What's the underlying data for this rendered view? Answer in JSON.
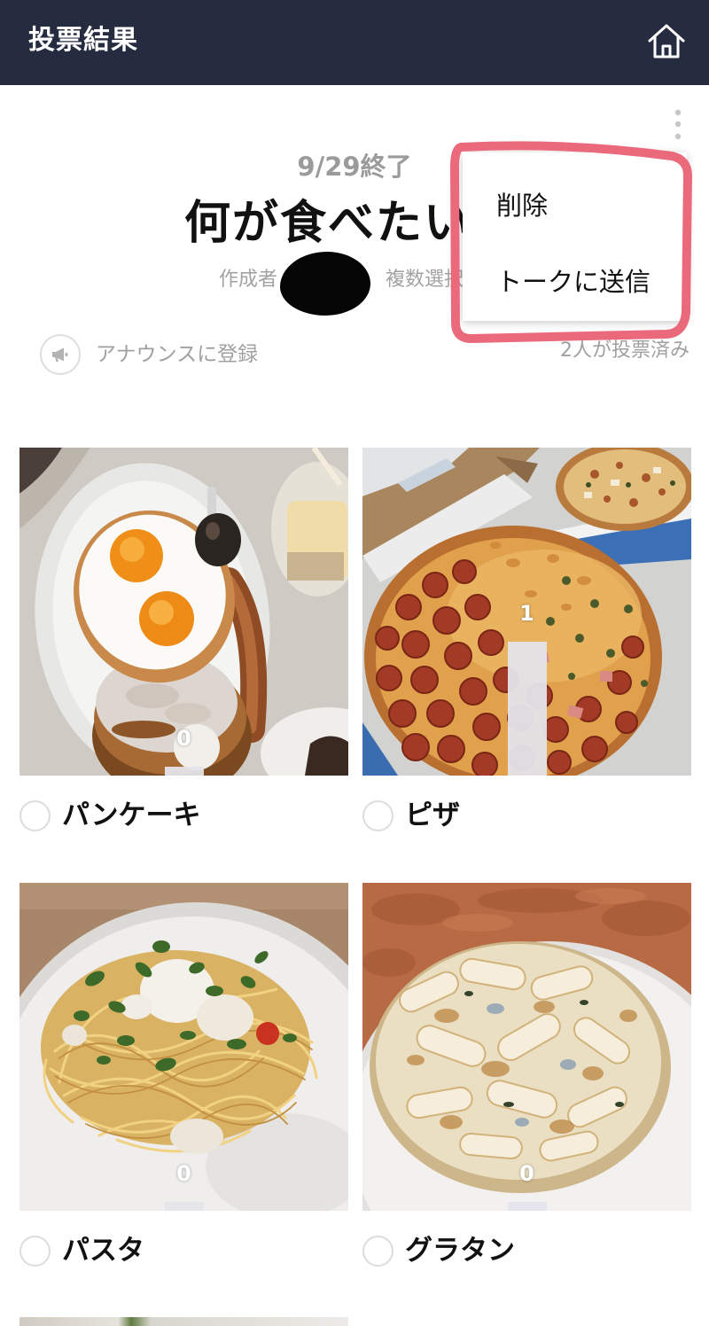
{
  "header": {
    "title": "投票結果",
    "home_icon": "home-icon"
  },
  "poll": {
    "more_icon": "more-vertical-icon",
    "status": "9/29終了",
    "title": "何が食べたい",
    "creator_label": "作成者",
    "selection_mode": "複数選択",
    "announce": {
      "icon": "megaphone-icon",
      "label": "アナウンスに登録"
    },
    "voters": "2人が投票済み"
  },
  "menu": {
    "items": [
      {
        "label": "削除"
      },
      {
        "label": "トークに送信"
      }
    ]
  },
  "options": [
    {
      "label": "パンケーキ",
      "votes": 0,
      "photo": "pancake-photo"
    },
    {
      "label": "ピザ",
      "votes": 1,
      "photo": "pizza-photo"
    },
    {
      "label": "パスタ",
      "votes": 0,
      "photo": "pasta-photo"
    },
    {
      "label": "グラタン",
      "votes": 0,
      "photo": "gratin-photo"
    }
  ],
  "colors": {
    "header_bg": "#262c40",
    "muted_text": "#9b9b9b",
    "annotation": "#ea6a7c",
    "vote_bar": "#e4e4ea"
  }
}
